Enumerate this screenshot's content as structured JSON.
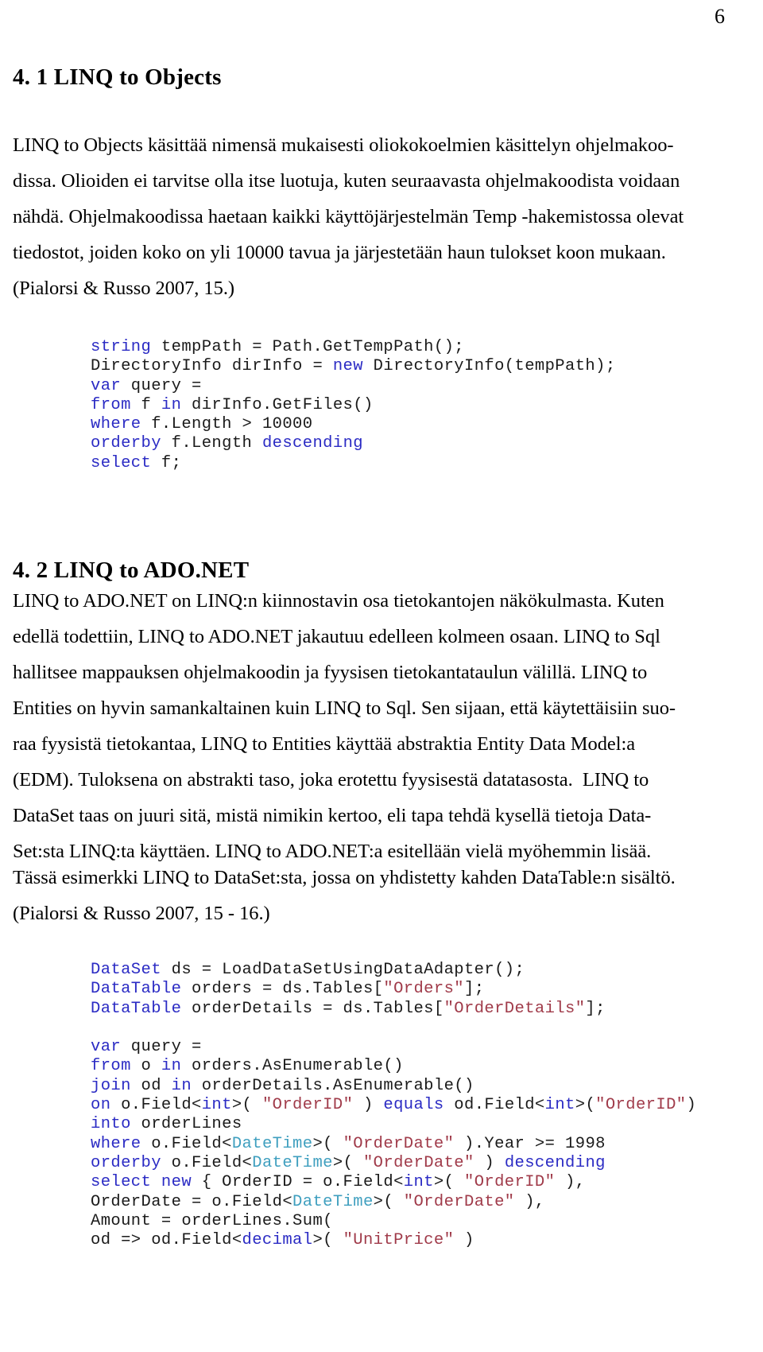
{
  "document": {
    "page_number": "6",
    "language": "fi"
  },
  "sections": [
    {
      "id": "4.1",
      "heading": "4. 1 LINQ to Objects",
      "body": "LINQ to Objects käsittää nimensä mukaisesti oliokokoelmien käsittelyn ohjelmakoo-\ndissa. Olioiden ei tarvitse olla itse luotuja, kuten seuraavasta ohjelmakoodista voidaan\nnähdä. Ohjelmakoodissa haetaan kaikki käyttöjärjestelmän Temp -hakemistossa olevat\ntiedostot, joiden koko on yli 10000 tavua ja järjestetään haun tulokset koon mukaan.\n(Pialorsi & Russo 2007, 15.)"
    },
    {
      "id": "4.2",
      "heading": "4. 2 LINQ to ADO.NET",
      "body": "LINQ to ADO.NET on LINQ:n kiinnostavin osa tietokantojen näkökulmasta. Kuten\nedellä todettiin, LINQ to ADO.NET jakautuu edelleen kolmeen osaan. LINQ to Sql\nhallitsee mappauksen ohjelmakoodin ja fyysisen tietokantataulun välillä. LINQ to\nEntities on hyvin samankaltainen kuin LINQ to Sql. Sen sijaan, että käytettäisiin suo-\nraa fyysistä tietokantaa, LINQ to Entities käyttää abstraktia Entity Data Model:a\n(EDM). Tuloksena on abstrakti taso, joka erotettu fyysisestä datatasosta.  LINQ to\nDataSet taas on juuri sitä, mistä nimikin kertoo, eli tapa tehdä kysellä tietoja Data-\nSet:sta LINQ:ta käyttäen. LINQ to ADO.NET:a esitellään vielä myöhemmin lisää.",
      "body2": "Tässä esimerkki LINQ to DataSet:sta, jossa on yhdistetty kahden DataTable:n sisältö.",
      "citation": "(Pialorsi & Russo 2007, 15 - 16.)"
    }
  ],
  "code_blocks": [
    {
      "id": "linq-to-objects-sample",
      "lines": [
        [
          {
            "t": "string",
            "c": "kw"
          },
          {
            "t": " tempPath = Path.GetTempPath();",
            "c": ""
          }
        ],
        [
          {
            "t": "DirectoryInfo dirInfo = ",
            "c": ""
          },
          {
            "t": "new",
            "c": "kw"
          },
          {
            "t": " DirectoryInfo(tempPath);",
            "c": ""
          }
        ],
        [
          {
            "t": "var",
            "c": "kw"
          },
          {
            "t": " query =",
            "c": ""
          }
        ],
        [
          {
            "t": "from",
            "c": "kw"
          },
          {
            "t": " f ",
            "c": ""
          },
          {
            "t": "in",
            "c": "kw"
          },
          {
            "t": " dirInfo.GetFiles()",
            "c": ""
          }
        ],
        [
          {
            "t": "where",
            "c": "kw"
          },
          {
            "t": " f.Length > 10000",
            "c": ""
          }
        ],
        [
          {
            "t": "orderby",
            "c": "kw"
          },
          {
            "t": " f.Length ",
            "c": ""
          },
          {
            "t": "descending",
            "c": "kw"
          }
        ],
        [
          {
            "t": "select",
            "c": "kw"
          },
          {
            "t": " f;",
            "c": ""
          }
        ]
      ]
    },
    {
      "id": "linq-to-dataset-sample",
      "lines": [
        [
          {
            "t": "DataSet",
            "c": "kw"
          },
          {
            "t": " ds = LoadDataSetUsingDataAdapter();",
            "c": ""
          }
        ],
        [
          {
            "t": "DataTable",
            "c": "kw"
          },
          {
            "t": " orders = ds.Tables[",
            "c": ""
          },
          {
            "t": "\"Orders\"",
            "c": "str"
          },
          {
            "t": "];",
            "c": ""
          }
        ],
        [
          {
            "t": "DataTable",
            "c": "kw"
          },
          {
            "t": " orderDetails = ds.Tables[",
            "c": ""
          },
          {
            "t": "\"OrderDetails\"",
            "c": "str"
          },
          {
            "t": "];",
            "c": ""
          }
        ],
        [
          {
            "t": "",
            "c": ""
          }
        ],
        [
          {
            "t": "var",
            "c": "kw"
          },
          {
            "t": " query =",
            "c": ""
          }
        ],
        [
          {
            "t": "from",
            "c": "kw"
          },
          {
            "t": " o ",
            "c": ""
          },
          {
            "t": "in",
            "c": "kw"
          },
          {
            "t": " orders.AsEnumerable()",
            "c": ""
          }
        ],
        [
          {
            "t": "join",
            "c": "kw"
          },
          {
            "t": " od ",
            "c": ""
          },
          {
            "t": "in",
            "c": "kw"
          },
          {
            "t": " orderDetails.AsEnumerable()",
            "c": ""
          }
        ],
        [
          {
            "t": "on",
            "c": "kw"
          },
          {
            "t": " o.Field<",
            "c": ""
          },
          {
            "t": "int",
            "c": "kw"
          },
          {
            "t": ">( ",
            "c": ""
          },
          {
            "t": "\"OrderID\"",
            "c": "str"
          },
          {
            "t": " ) ",
            "c": ""
          },
          {
            "t": "equals",
            "c": "kw"
          },
          {
            "t": " od.Field<",
            "c": ""
          },
          {
            "t": "int",
            "c": "kw"
          },
          {
            "t": ">(",
            "c": ""
          },
          {
            "t": "\"OrderID\"",
            "c": "str"
          },
          {
            "t": ")",
            "c": ""
          }
        ],
        [
          {
            "t": "into",
            "c": "kw"
          },
          {
            "t": " orderLines",
            "c": ""
          }
        ],
        [
          {
            "t": "where",
            "c": "kw"
          },
          {
            "t": " o.Field<",
            "c": ""
          },
          {
            "t": "DateTime",
            "c": "typ"
          },
          {
            "t": ">( ",
            "c": ""
          },
          {
            "t": "\"OrderDate\"",
            "c": "str"
          },
          {
            "t": " ).Year >= 1998",
            "c": ""
          }
        ],
        [
          {
            "t": "orderby",
            "c": "kw"
          },
          {
            "t": " o.Field<",
            "c": ""
          },
          {
            "t": "DateTime",
            "c": "typ"
          },
          {
            "t": ">( ",
            "c": ""
          },
          {
            "t": "\"OrderDate\"",
            "c": "str"
          },
          {
            "t": " ) ",
            "c": ""
          },
          {
            "t": "descending",
            "c": "kw"
          }
        ],
        [
          {
            "t": "select",
            "c": "kw"
          },
          {
            "t": " ",
            "c": ""
          },
          {
            "t": "new",
            "c": "kw"
          },
          {
            "t": " { OrderID = o.Field<",
            "c": ""
          },
          {
            "t": "int",
            "c": "kw"
          },
          {
            "t": ">( ",
            "c": ""
          },
          {
            "t": "\"OrderID\"",
            "c": "str"
          },
          {
            "t": " ),",
            "c": ""
          }
        ],
        [
          {
            "t": "OrderDate = o.Field<",
            "c": ""
          },
          {
            "t": "DateTime",
            "c": "typ"
          },
          {
            "t": ">( ",
            "c": ""
          },
          {
            "t": "\"OrderDate\"",
            "c": "str"
          },
          {
            "t": " ),",
            "c": ""
          }
        ],
        [
          {
            "t": "Amount = orderLines.Sum(",
            "c": ""
          }
        ],
        [
          {
            "t": "od => od.Field<",
            "c": ""
          },
          {
            "t": "decimal",
            "c": "kw"
          },
          {
            "t": ">( ",
            "c": ""
          },
          {
            "t": "\"UnitPrice\"",
            "c": "str"
          },
          {
            "t": " )",
            "c": ""
          }
        ]
      ]
    }
  ],
  "colors": {
    "keyword": "#2b2bc4",
    "type": "#3f9fbf",
    "string": "#a03b4a",
    "text": "#1a1a1a",
    "background": "#ffffff"
  }
}
